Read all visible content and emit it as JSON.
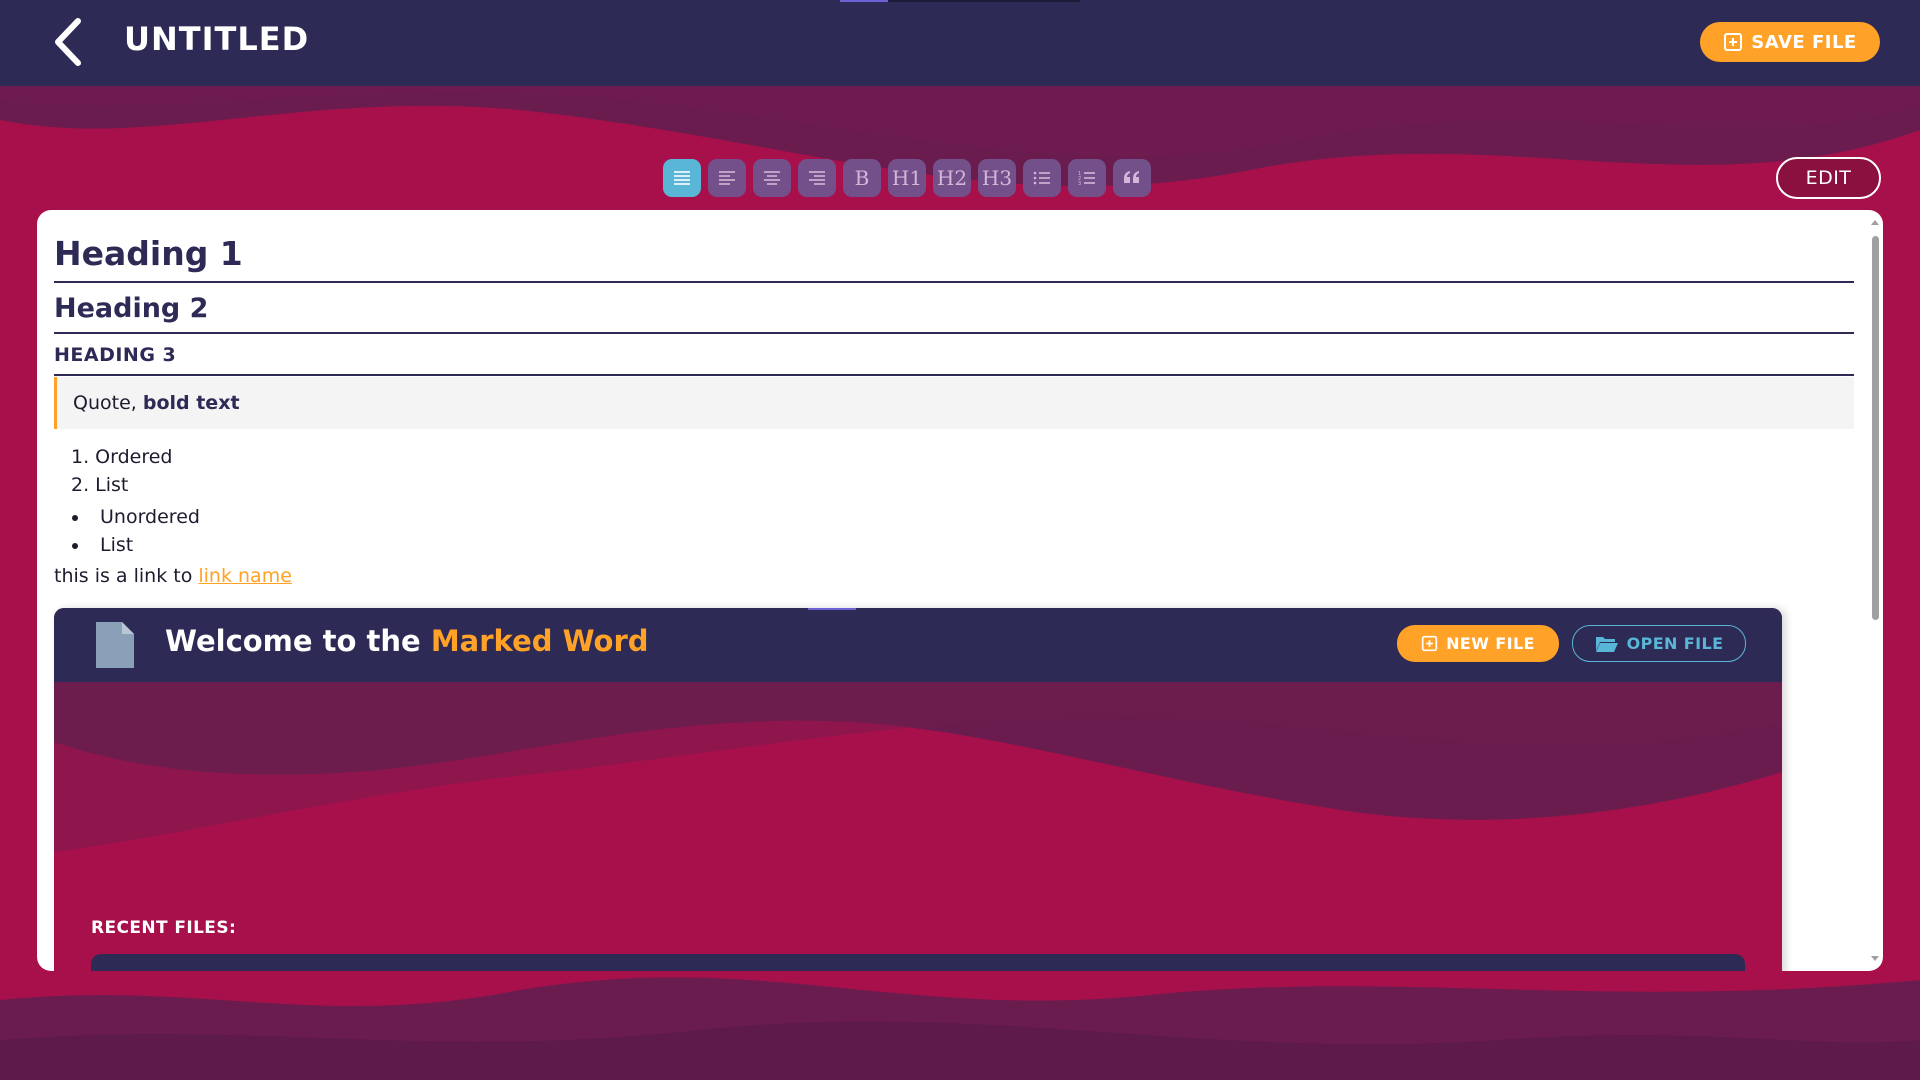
{
  "header": {
    "title": "UNTITLED",
    "back_icon": "chevron-left-icon",
    "save_label": "SAVE FILE",
    "save_icon": "plus-square-icon"
  },
  "toolbar": {
    "buttons": [
      {
        "name": "justify",
        "icon": "align-justify-icon",
        "active": true
      },
      {
        "name": "align-left",
        "icon": "align-left-icon",
        "active": false
      },
      {
        "name": "align-center",
        "icon": "align-center-icon",
        "active": false
      },
      {
        "name": "align-right",
        "icon": "align-right-icon",
        "active": false
      },
      {
        "name": "bold",
        "label": "B",
        "active": false
      },
      {
        "name": "h1",
        "label": "H1",
        "active": false
      },
      {
        "name": "h2",
        "label": "H2",
        "active": false
      },
      {
        "name": "h3",
        "label": "H3",
        "active": false
      },
      {
        "name": "unordered-list",
        "icon": "list-icon",
        "active": false
      },
      {
        "name": "ordered-list",
        "icon": "ordered-list-icon",
        "active": false
      },
      {
        "name": "quote",
        "icon": "quote-icon",
        "active": false
      }
    ],
    "edit_label": "EDIT"
  },
  "document": {
    "heading1": "Heading 1",
    "heading2": "Heading 2",
    "heading3": "HEADING 3",
    "quote_text": "Quote, ",
    "quote_bold": "bold text",
    "ordered_items": [
      "1. Ordered",
      "2. List"
    ],
    "unordered_items": [
      "Unordered",
      "List"
    ],
    "link_prefix": "this is a link to ",
    "link_text": "link name"
  },
  "embed": {
    "title_plain": "Welcome to the ",
    "title_accent": "Marked Word",
    "new_file_label": "NEW FILE",
    "open_file_label": "OPEN FILE",
    "recent_label": "RECENT FILES:"
  },
  "colors": {
    "navy": "#2d2a55",
    "crimson": "#a8104b",
    "orange": "#ffa227",
    "cyan": "#5ab6d6",
    "toolbar_button": "#74508a"
  }
}
